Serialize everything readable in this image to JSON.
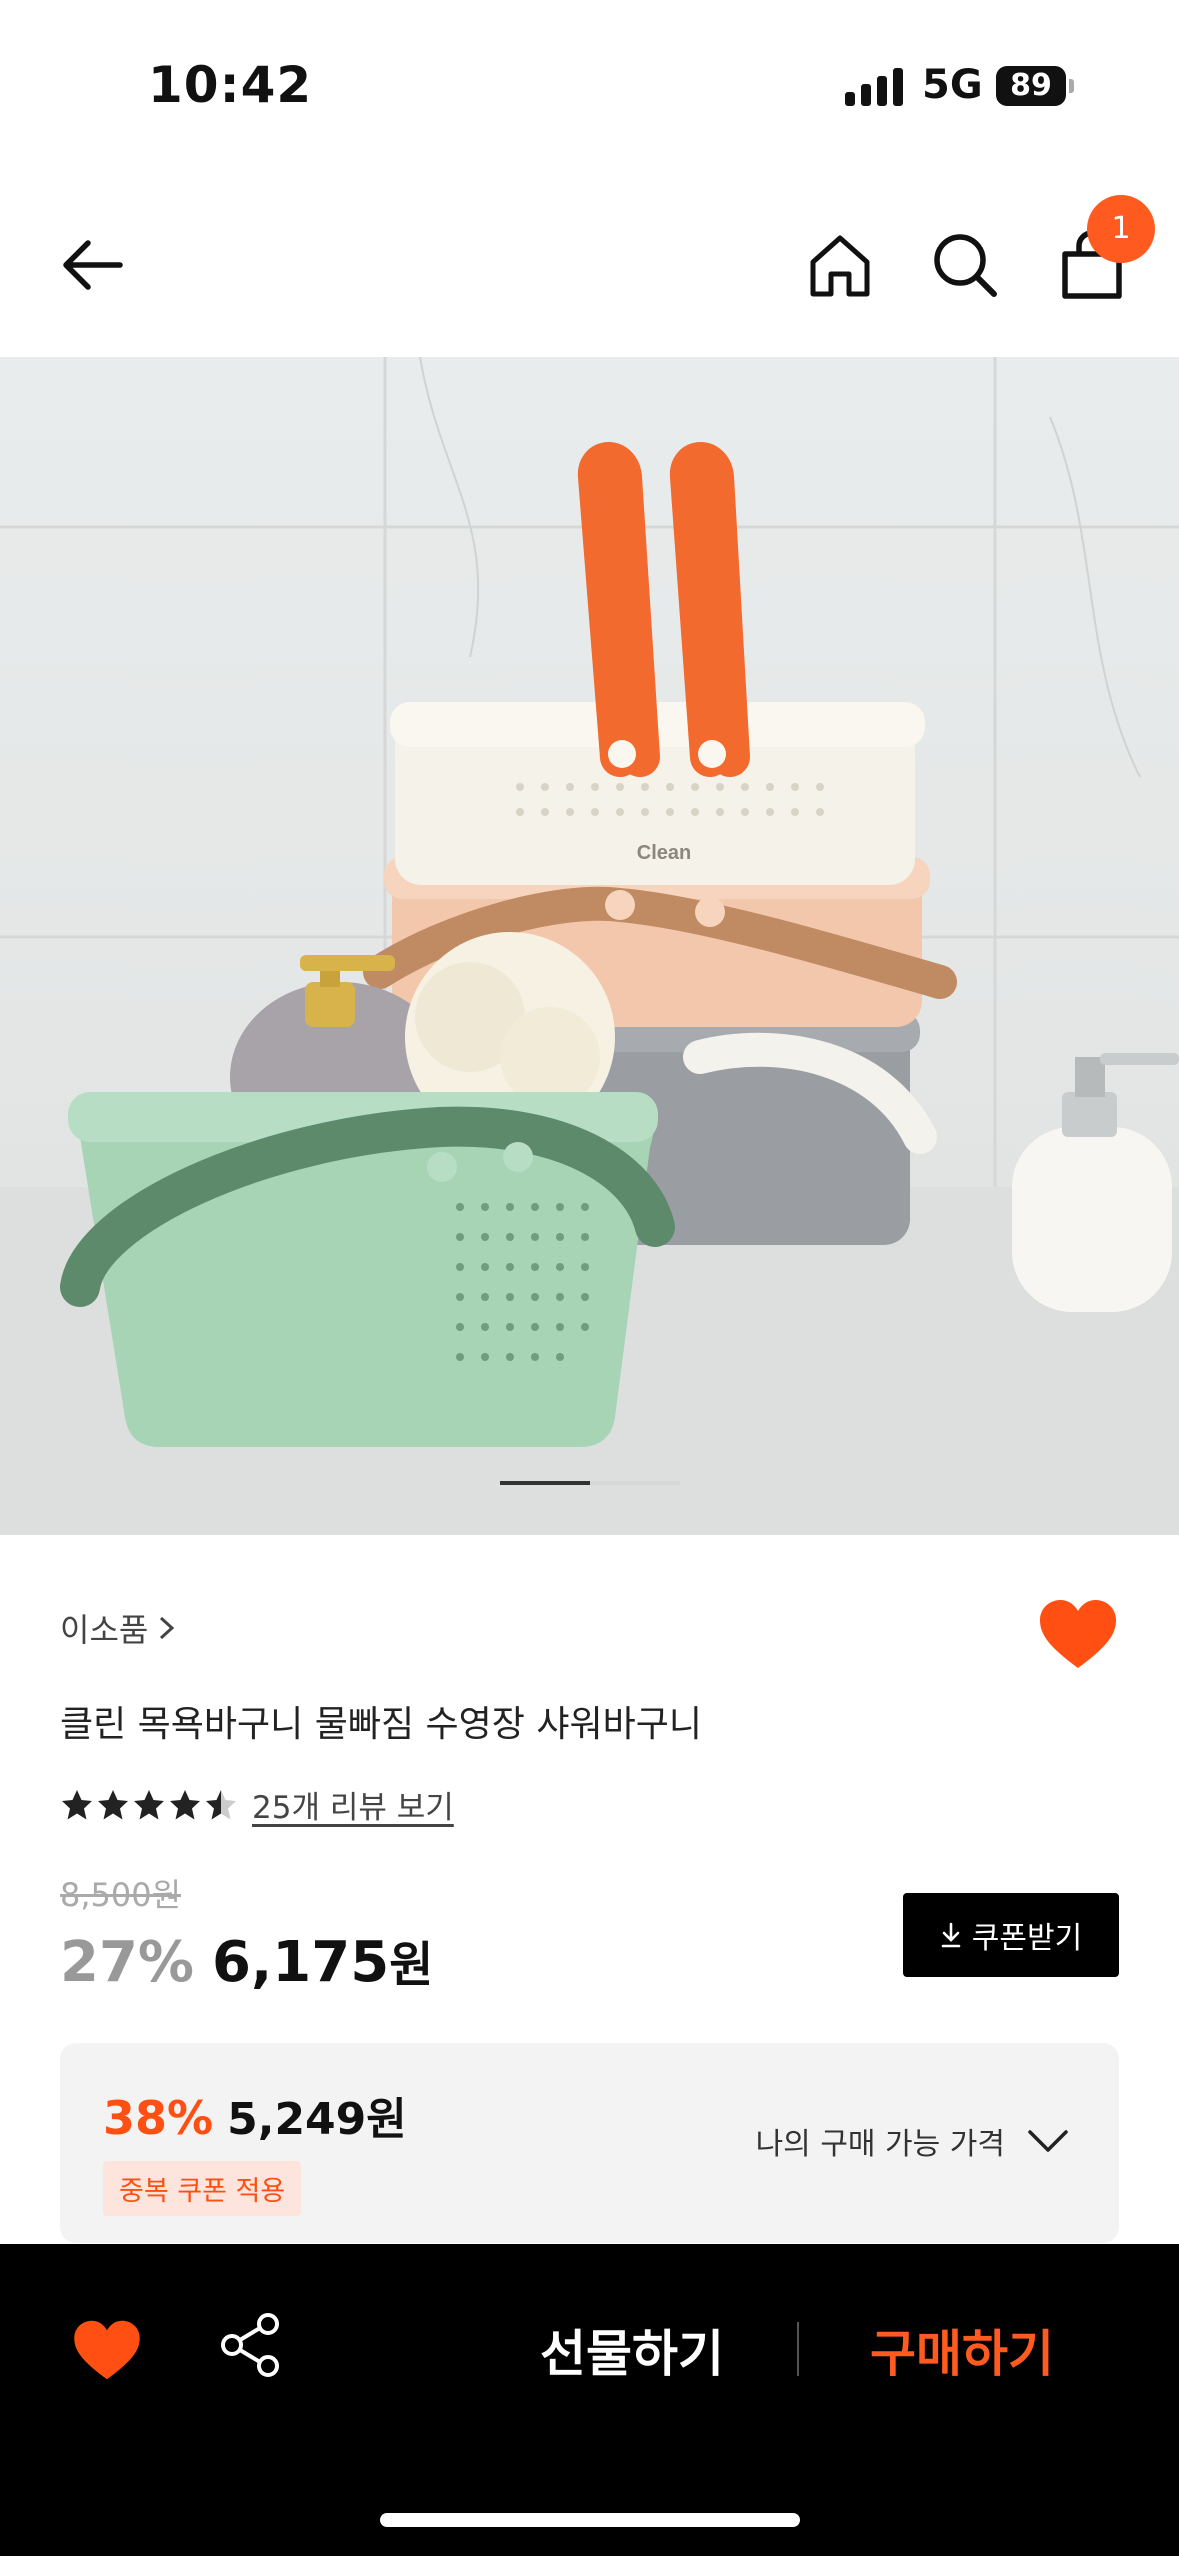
{
  "status_bar": {
    "time": "10:42",
    "network": "5G",
    "battery": "89"
  },
  "nav": {
    "cart_count": "1"
  },
  "product": {
    "brand": "이소품",
    "title": "클린 목욕바구니 물빠짐 수영장 샤워바구니",
    "rating": 4.5,
    "review_link": "25개 리뷰 보기",
    "original_price": "8,500원",
    "discount": "27%",
    "price_number": "6,175",
    "price_unit": "원",
    "coupon_button": "쿠폰받기",
    "image_text": "Clean"
  },
  "best_price": {
    "discount": "38%",
    "price": "5,249원",
    "badge": "중복 쿠폰 적용",
    "my_price_label": "나의 구매 가능 가격"
  },
  "bottom_bar": {
    "gift_label": "선물하기",
    "buy_label": "구매하기"
  },
  "colors": {
    "accent": "#ff5a1f",
    "heart": "#ff4f12"
  },
  "icons": [
    "back-arrow-icon",
    "home-icon",
    "search-icon",
    "shopping-bag-icon",
    "heart-icon",
    "star-icon",
    "download-icon",
    "chevron-down-icon",
    "share-icon"
  ]
}
